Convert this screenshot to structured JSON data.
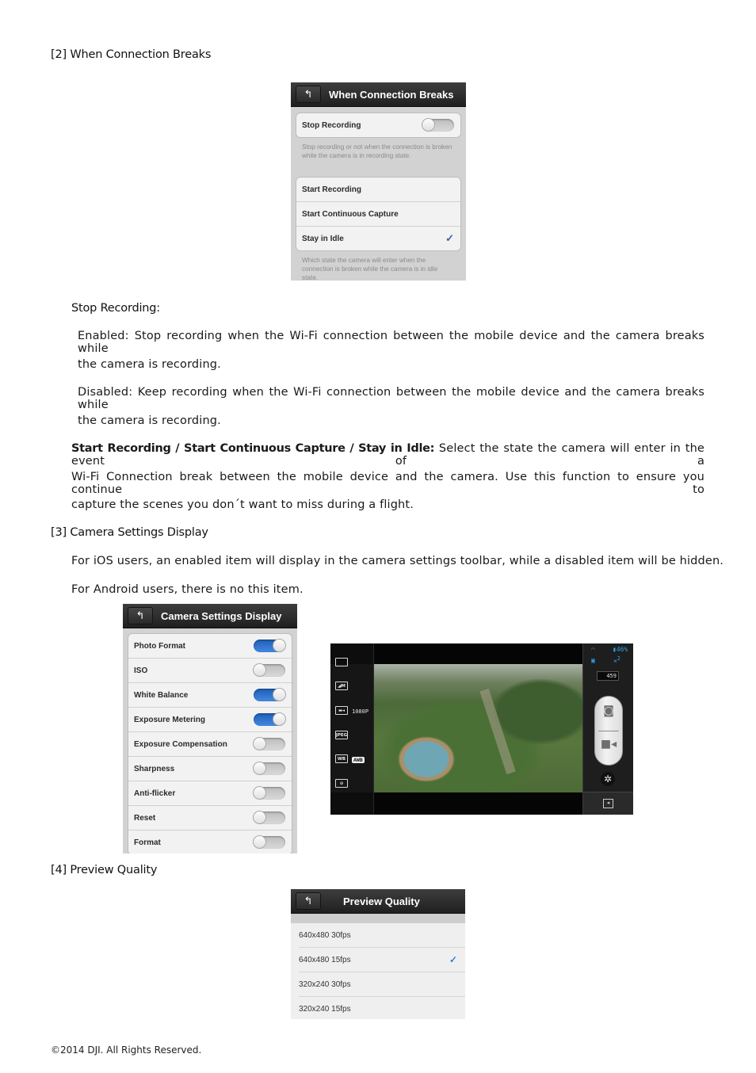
{
  "section2": {
    "heading": "[2] When Connection Breaks",
    "screenshot": {
      "title": "When Connection Breaks",
      "back_icon": "back-arrow-icon",
      "toggle_row": {
        "label": "Stop Recording",
        "enabled": false
      },
      "toggle_note": "Stop recording or not when the connection is broken while the camera is in recording state.",
      "options": [
        {
          "label": "Start Recording",
          "selected": false
        },
        {
          "label": "Start Continuous Capture",
          "selected": false
        },
        {
          "label": "Stay in Idle",
          "selected": true
        }
      ],
      "check_glyph": "✓",
      "options_note": "Which state the camera will enter when the connection is broken while the camera is in idle state."
    },
    "stop_recording": {
      "heading": "Stop Recording:",
      "enabled_line1": "Enabled: Stop recording when the Wi-Fi connection between the mobile device and the camera breaks while",
      "enabled_line2": "the camera is recording.",
      "disabled_line1": "Disabled: Keep recording when the Wi-Fi connection between the mobile device and the camera breaks while",
      "disabled_line2": "the camera is recording."
    },
    "states": {
      "bold": "Start Recording / Start Continuous Capture / Stay in Idle:",
      "line1_rest": " Select the state the camera will enter in the event of a",
      "line2": "Wi-Fi Connection break between the mobile device and the camera. Use this function to ensure you continue to",
      "line3": "capture the scenes you don´t want to miss during a flight."
    }
  },
  "section3": {
    "heading": "[3] Camera Settings Display",
    "line1": "For iOS users, an enabled item will display in the camera settings toolbar, while a disabled item will be hidden.",
    "line2": "For Android users, there is no this item.",
    "screenshot": {
      "title": "Camera Settings Display",
      "items": [
        {
          "label": "Photo Format",
          "enabled": true
        },
        {
          "label": "ISO",
          "enabled": false
        },
        {
          "label": "White Balance",
          "enabled": true
        },
        {
          "label": "Exposure Metering",
          "enabled": true
        },
        {
          "label": "Exposure Compensation",
          "enabled": false
        },
        {
          "label": "Sharpness",
          "enabled": false
        },
        {
          "label": "Anti-flicker",
          "enabled": false
        },
        {
          "label": "Reset",
          "enabled": false
        },
        {
          "label": "Format",
          "enabled": false
        }
      ]
    },
    "camera_view": {
      "left_toolbar": [
        {
          "icon": "aspect-ratio-icon",
          "glyph": "",
          "label": ""
        },
        {
          "icon": "photo-size-icon",
          "glyph": "◢M",
          "label": ""
        },
        {
          "icon": "video-resolution-icon",
          "glyph": "▬◂",
          "label": "1080P"
        },
        {
          "icon": "photo-format-icon",
          "glyph": "JPEG",
          "label": ""
        },
        {
          "icon": "white-balance-icon",
          "glyph": "WB",
          "label": "AWB"
        },
        {
          "icon": "exposure-icon",
          "glyph": "⊙",
          "label": ""
        }
      ],
      "battery": "46%",
      "gps_count": "2",
      "shots_remaining": "459",
      "colors": {
        "status_blue": "#2aa3e8"
      }
    }
  },
  "section4": {
    "heading": "[4] Preview Quality",
    "screenshot": {
      "title": "Preview Quality",
      "options": [
        {
          "label": "640x480 30fps",
          "selected": false
        },
        {
          "label": "640x480 15fps",
          "selected": true
        },
        {
          "label": "320x240 30fps",
          "selected": false
        },
        {
          "label": "320x240 15fps",
          "selected": false
        }
      ],
      "check_glyph": "✓",
      "check_color": "#2f7fe0"
    }
  },
  "footer": {
    "copyright": "©2014 DJI. All Rights Reserved."
  }
}
